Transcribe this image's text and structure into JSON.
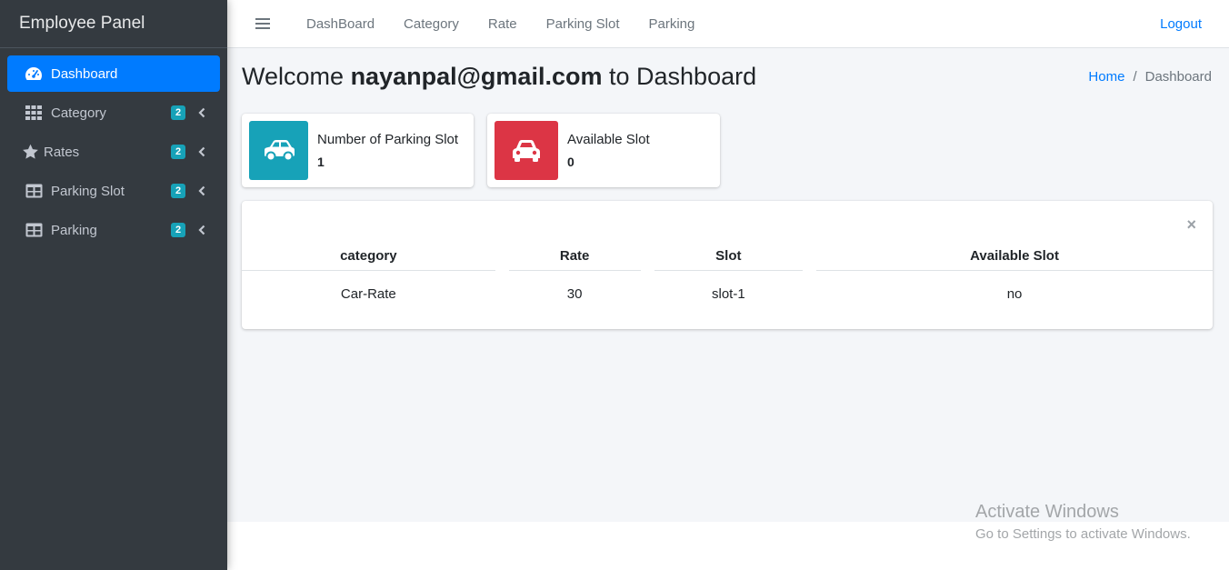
{
  "sidebar": {
    "brand": "Employee Panel",
    "items": [
      {
        "label": "Dashboard",
        "icon": "tachometer-icon"
      },
      {
        "label": "Category",
        "icon": "grid-icon",
        "badge": "2"
      },
      {
        "label": "Rates",
        "icon": "star-icon",
        "badge": "2"
      },
      {
        "label": "Parking Slot",
        "icon": "table-icon",
        "badge": "2"
      },
      {
        "label": "Parking",
        "icon": "table-icon",
        "badge": "2"
      }
    ]
  },
  "topbar": {
    "links": [
      "DashBoard",
      "Category",
      "Rate",
      "Parking Slot",
      "Parking"
    ],
    "logout": "Logout"
  },
  "header": {
    "welcome_prefix": "Welcome",
    "user_email": "nayanpal@gmail.com",
    "welcome_suffix": "to Dashboard",
    "breadcrumb_home": "Home",
    "breadcrumb_sep": "/",
    "breadcrumb_current": "Dashboard"
  },
  "info_boxes": [
    {
      "title": "Number of Parking Slot",
      "value": "1",
      "color": "#17a2b8",
      "icon": "car-side-icon"
    },
    {
      "title": "Available Slot",
      "value": "0",
      "color": "#dc3545",
      "icon": "car-front-icon"
    }
  ],
  "table": {
    "close": "×",
    "headers": [
      "category",
      "Rate",
      "Slot",
      "Available Slot"
    ],
    "rows": [
      [
        "Car-Rate",
        "30",
        "slot-1",
        "no"
      ]
    ]
  },
  "watermark": {
    "line1": "Activate Windows",
    "line2": "Go to Settings to activate Windows."
  },
  "colors": {
    "accent": "#007bff",
    "sidebar_bg": "#343a40",
    "badge": "#17a2b8"
  }
}
